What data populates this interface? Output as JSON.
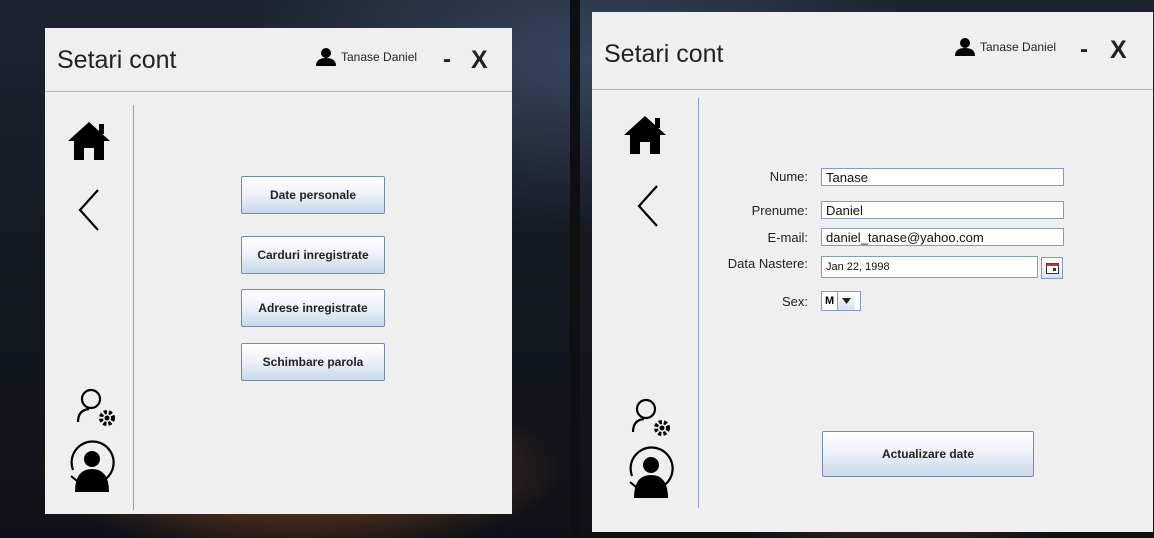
{
  "window_left": {
    "title": "Setari cont",
    "user_name": "Tanase Daniel",
    "minimize_label": "-",
    "close_label": "X",
    "menu_buttons": [
      {
        "label": "Date personale"
      },
      {
        "label": "Carduri inregistrate"
      },
      {
        "label": "Adrese inregistrate"
      },
      {
        "label": "Schimbare parola"
      }
    ]
  },
  "window_right": {
    "title": "Setari cont",
    "user_name": "Tanase Daniel",
    "minimize_label": "-",
    "close_label": "X",
    "form": {
      "nume": {
        "label": "Nume:",
        "value": "Tanase"
      },
      "prenume": {
        "label": "Prenume:",
        "value": "Daniel"
      },
      "email": {
        "label": "E-mail:",
        "value": "daniel_tanase@yahoo.com"
      },
      "data_nastere": {
        "label": "Data Nastere:",
        "value": "Jan 22, 1998"
      },
      "sex": {
        "label": "Sex:",
        "value": "M"
      }
    },
    "submit_label": "Actualizare date"
  },
  "icons": {
    "home": "home-icon",
    "back": "back-chevron-icon",
    "user_settings": "user-settings-icon",
    "logout": "user-switch-icon",
    "user": "user-icon",
    "calendar": "calendar-icon",
    "dropdown": "chevron-down-icon"
  }
}
